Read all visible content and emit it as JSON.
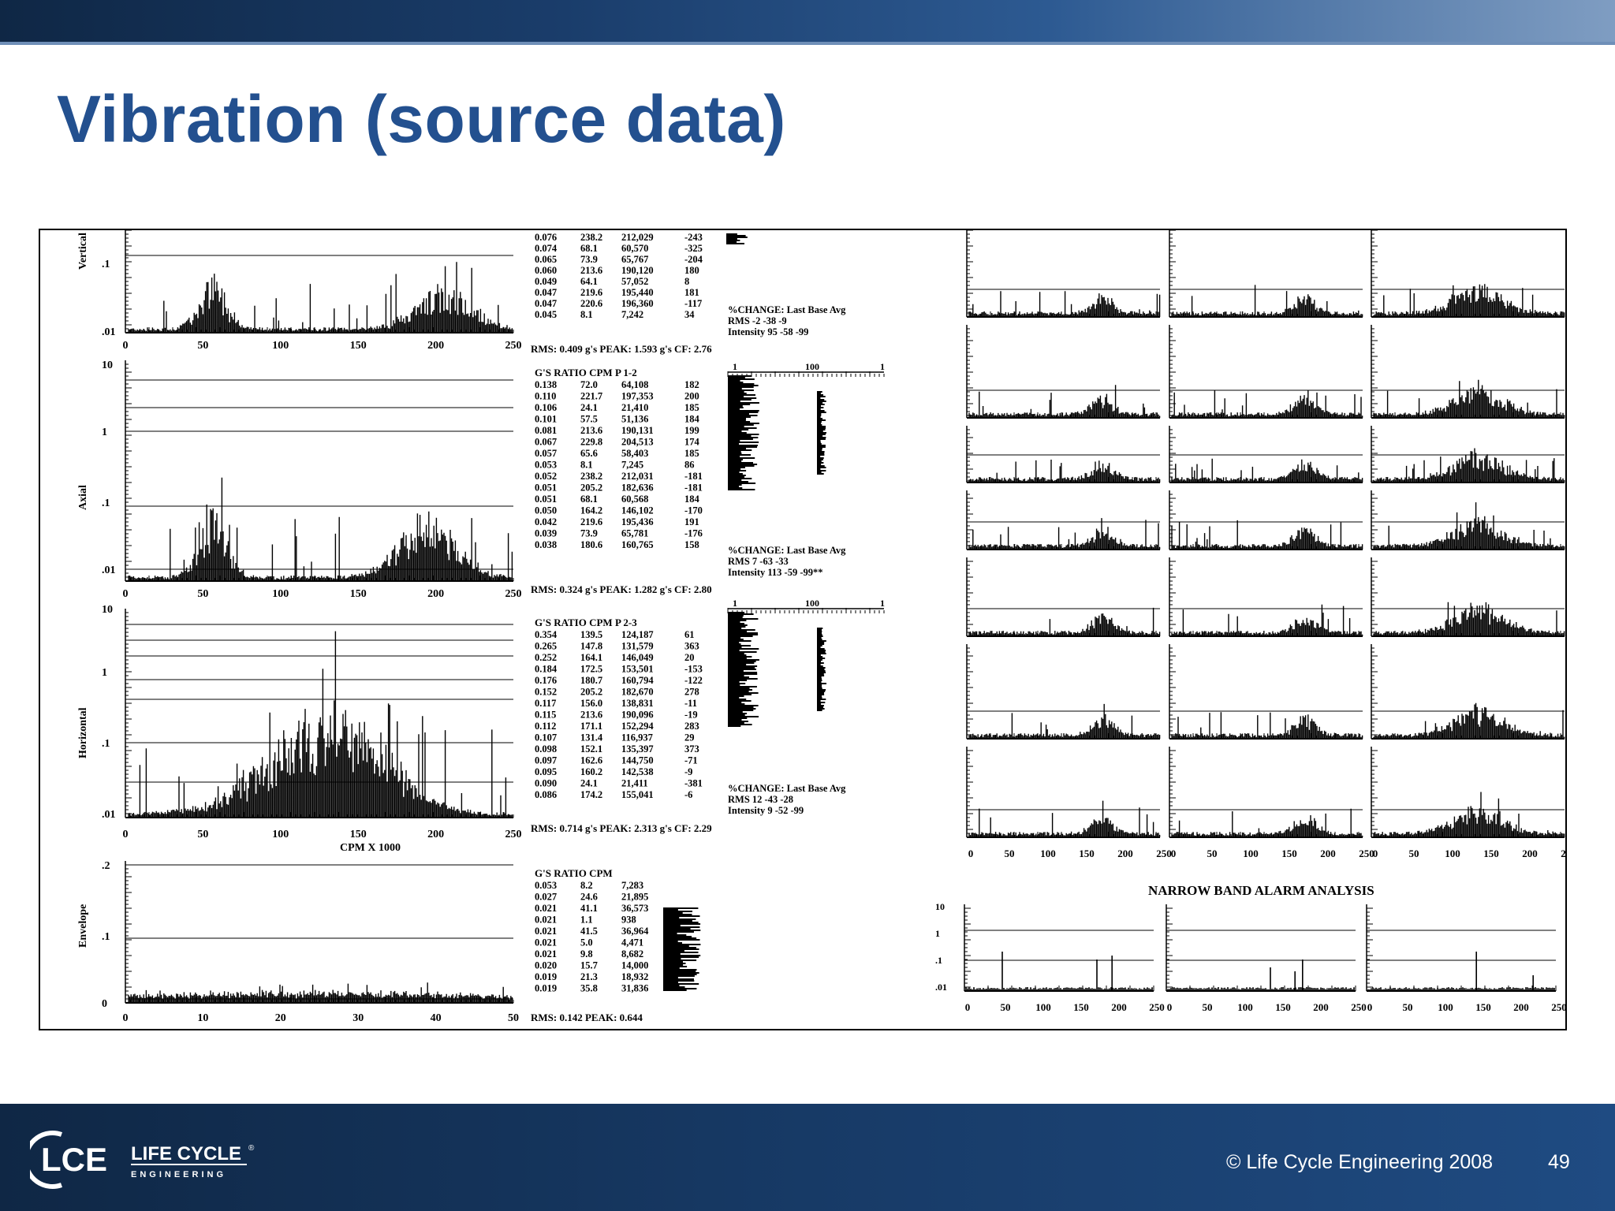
{
  "slide": {
    "title": "Vibration (source data)",
    "copyright": "© Life Cycle Engineering 2008",
    "page_number": "49",
    "logo": {
      "mark": "LCE",
      "name": "LIFE CYCLE",
      "sub": "ENGINEERING",
      "reg": "®"
    }
  },
  "report": {
    "axis_labels": {
      "vertical": "Vertical",
      "axial": "Axial",
      "horizontal": "Horizontal",
      "envelope": "Envelope",
      "cpm": "CPM X 1000"
    },
    "tick_labels": {
      "vertical_y": [
        ".1",
        ".01"
      ],
      "axial_y": [
        "10",
        "1",
        ".1",
        ".01"
      ],
      "horizontal_y": [
        "10",
        "1",
        ".1",
        ".01"
      ],
      "envelope_y": [
        ".2",
        ".1",
        "0"
      ],
      "x_250": [
        "0",
        "50",
        "100",
        "150",
        "200",
        "250"
      ],
      "x_50": [
        "0",
        "10",
        "20",
        "30",
        "40",
        "50"
      ],
      "alarm_y": [
        "10",
        "1",
        ".1",
        ".01"
      ]
    },
    "tables": [
      {
        "header": "",
        "rows": [
          [
            "0.076",
            "238.2",
            "212,029",
            "-243"
          ],
          [
            "0.074",
            "68.1",
            "60,570",
            "-325"
          ],
          [
            "0.065",
            "73.9",
            "65,767",
            "-204"
          ],
          [
            "0.060",
            "213.6",
            "190,120",
            "180"
          ],
          [
            "0.049",
            "64.1",
            "57,052",
            "8"
          ],
          [
            "0.047",
            "219.6",
            "195,440",
            "181"
          ],
          [
            "0.047",
            "220.6",
            "196,360",
            "-117"
          ],
          [
            "0.045",
            "8.1",
            "7,242",
            "34"
          ]
        ],
        "summary": "RMS: 0.409  g's   PEAK: 1.593  g's   CF: 2.76"
      },
      {
        "header": "G'S    RATIO  CPM  P 1-2",
        "rows": [
          [
            "0.138",
            "72.0",
            "64,108",
            "182"
          ],
          [
            "0.110",
            "221.7",
            "197,353",
            "200"
          ],
          [
            "0.106",
            "24.1",
            "21,410",
            "185"
          ],
          [
            "0.101",
            "57.5",
            "51,136",
            "184"
          ],
          [
            "0.081",
            "213.6",
            "190,131",
            "199"
          ],
          [
            "0.067",
            "229.8",
            "204,513",
            "174"
          ],
          [
            "0.057",
            "65.6",
            "58,403",
            "185"
          ],
          [
            "0.053",
            "8.1",
            "7,245",
            "86"
          ],
          [
            "0.052",
            "238.2",
            "212,031",
            "-181"
          ],
          [
            "0.051",
            "205.2",
            "182,636",
            "-181"
          ],
          [
            "0.051",
            "68.1",
            "60,568",
            "184"
          ],
          [
            "0.050",
            "164.2",
            "146,102",
            "-170"
          ],
          [
            "0.042",
            "219.6",
            "195,436",
            "191"
          ],
          [
            "0.039",
            "73.9",
            "65,781",
            "-176"
          ],
          [
            "0.038",
            "180.6",
            "160,765",
            "158"
          ]
        ],
        "summary": "RMS: 0.324  g's   PEAK: 1.282  g's   CF: 2.80"
      },
      {
        "header": "G'S    RATIO  CPM  P 2-3",
        "rows": [
          [
            "0.354",
            "139.5",
            "124,187",
            "61"
          ],
          [
            "0.265",
            "147.8",
            "131,579",
            "363"
          ],
          [
            "0.252",
            "164.1",
            "146,049",
            "20"
          ],
          [
            "0.184",
            "172.5",
            "153,501",
            "-153"
          ],
          [
            "0.176",
            "180.7",
            "160,794",
            "-122"
          ],
          [
            "0.152",
            "205.2",
            "182,670",
            "278"
          ],
          [
            "0.117",
            "156.0",
            "138,831",
            "-11"
          ],
          [
            "0.115",
            "213.6",
            "190,096",
            "-19"
          ],
          [
            "0.112",
            "171.1",
            "152,294",
            "283"
          ],
          [
            "0.107",
            "131.4",
            "116,937",
            "29"
          ],
          [
            "0.098",
            "152.1",
            "135,397",
            "373"
          ],
          [
            "0.097",
            "162.6",
            "144,750",
            "-71"
          ],
          [
            "0.095",
            "160.2",
            "142,538",
            "-9"
          ],
          [
            "0.090",
            "24.1",
            "21,411",
            "-381"
          ],
          [
            "0.086",
            "174.2",
            "155,041",
            "-6"
          ]
        ],
        "summary": "RMS: 0.714  g's   PEAK: 2.313  g's   CF: 2.29"
      },
      {
        "header": "G'S    RATIO    CPM",
        "rows": [
          [
            "0.053",
            "8.2",
            "7,283",
            ""
          ],
          [
            "0.027",
            "24.6",
            "21,895",
            ""
          ],
          [
            "0.021",
            "41.1",
            "36,573",
            ""
          ],
          [
            "0.021",
            "1.1",
            "938",
            ""
          ],
          [
            "0.021",
            "41.5",
            "36,964",
            ""
          ],
          [
            "0.021",
            "5.0",
            "4,471",
            ""
          ],
          [
            "0.021",
            "9.8",
            "8,682",
            ""
          ],
          [
            "0.020",
            "15.7",
            "14,000",
            ""
          ],
          [
            "0.019",
            "21.3",
            "18,932",
            ""
          ],
          [
            "0.019",
            "35.8",
            "31,836",
            ""
          ]
        ],
        "summary": "RMS:  0.142 PEAK:  0.644"
      }
    ],
    "change_blocks": [
      {
        "title": "%CHANGE: Last Base Avg",
        "rms": "RMS        -2    -38    -9",
        "intensity": "Intensity   95   -58   -99"
      },
      {
        "title": "%CHANGE: Last Base Avg",
        "rms": "RMS         7    -63   -33",
        "intensity": "Intensity  113   -59   -99**"
      },
      {
        "title": "%CHANGE: Last Base Avg",
        "rms": "RMS        12    -43   -28",
        "intensity": "Intensity    9   -52   -99"
      }
    ],
    "mini_scale": {
      "left": "1",
      "right": "100",
      "end": "1"
    },
    "narrow_band_title": "NARROW BAND ALARM ANALYSIS"
  }
}
